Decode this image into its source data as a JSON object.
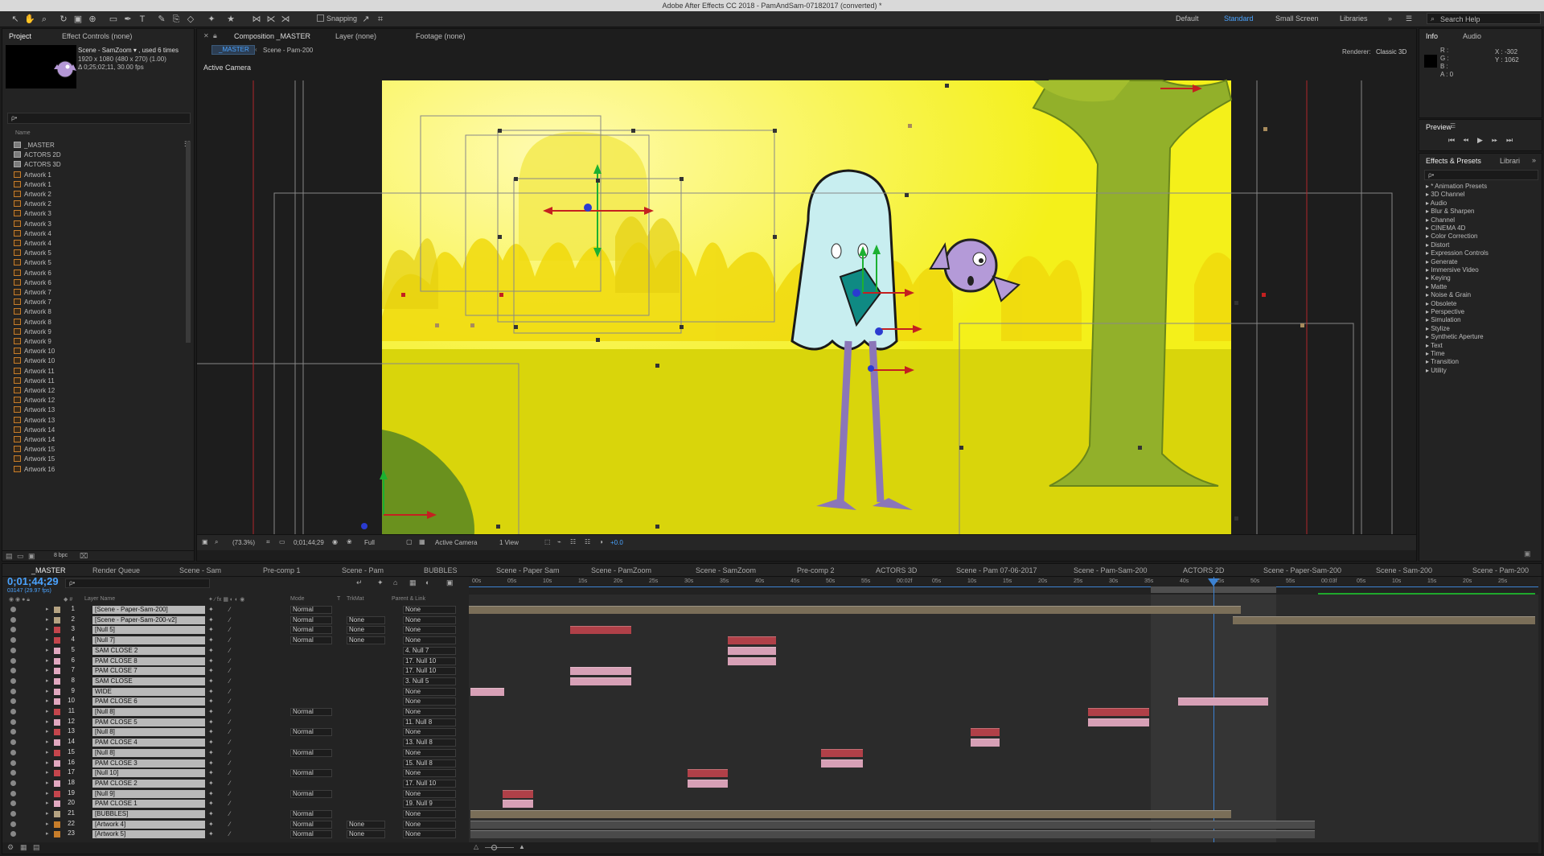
{
  "app": {
    "title": "Adobe After Effects CC 2018 - PamAndSam-07182017 (converted) *"
  },
  "workspaces": {
    "items": [
      "Default",
      "Standard",
      "Small Screen",
      "Libraries"
    ],
    "active": "Standard",
    "search_placeholder": "Search Help"
  },
  "project": {
    "tab_project": "Project",
    "tab_effect_controls": "Effect Controls (none)",
    "thumb_title": "Scene - SamZoom ▾ , used 6 times",
    "thumb_dims": "1920 x 1080 (480 x 270) (1.00)",
    "thumb_duration": "Δ 0;25;02;11, 30.00 fps",
    "search_value": "ρ•",
    "col_name": "Name",
    "bpc": "8 bpc",
    "items": [
      "_MASTER",
      "ACTORS 2D",
      "ACTORS 3D",
      "Artwork 1",
      "Artwork 1",
      "Artwork 2",
      "Artwork 2",
      "Artwork 3",
      "Artwork 3",
      "Artwork 4",
      "Artwork 4",
      "Artwork 5",
      "Artwork 5",
      "Artwork 6",
      "Artwork 6",
      "Artwork 7",
      "Artwork 7",
      "Artwork 8",
      "Artwork 8",
      "Artwork 9",
      "Artwork 9",
      "Artwork 10",
      "Artwork 10",
      "Artwork 11",
      "Artwork 11",
      "Artwork 12",
      "Artwork 12",
      "Artwork 13",
      "Artwork 13",
      "Artwork 14",
      "Artwork 14",
      "Artwork 15",
      "Artwork 15",
      "Artwork 16"
    ]
  },
  "composition": {
    "tab_label": "Composition _MASTER",
    "tab_layer": "Layer (none)",
    "tab_footage": "Footage (none)",
    "crumb_master": "_MASTER",
    "crumb_scene": "Scene - Pam-200",
    "renderer_label": "Renderer:",
    "renderer_value": "Classic 3D",
    "view_label": "Active Camera",
    "footer": {
      "zoom": "(73.3%)",
      "time": "0;01;44;29",
      "resolution": "Full",
      "camera": "Active Camera",
      "views": "1 View",
      "exposure": "+0.0"
    }
  },
  "info": {
    "tab_info": "Info",
    "tab_audio": "Audio",
    "r": "R :",
    "g": "G :",
    "b": "B :",
    "a": "A :  0",
    "x": "X : -302",
    "y": "Y : 1062"
  },
  "preview": {
    "title": "Preview"
  },
  "effects": {
    "tab": "Effects & Presets",
    "tab2": "Librari",
    "search_value": "ρ•",
    "items": [
      "* Animation Presets",
      "3D Channel",
      "Audio",
      "Blur & Sharpen",
      "Channel",
      "CINEMA 4D",
      "Color Correction",
      "Distort",
      "Expression Controls",
      "Generate",
      "Immersive Video",
      "Keying",
      "Matte",
      "Noise & Grain",
      "Obsolete",
      "Perspective",
      "Simulation",
      "Stylize",
      "Synthetic Aperture",
      "Text",
      "Time",
      "Transition",
      "Utility"
    ]
  },
  "timeline": {
    "tabs": [
      "_MASTER",
      "Render Queue",
      "Scene - Sam",
      "Pre-comp 1",
      "Scene - Pam",
      "BUBBLES",
      "Scene - Paper Sam",
      "Scene - PamZoom",
      "Scene - SamZoom",
      "Pre-comp 2",
      "ACTORS 3D",
      "Scene - Pam 07-06-2017",
      "Scene - Pam-Sam-200",
      "ACTORS 2D",
      "Scene - Paper-Sam-200",
      "Scene - Sam-200",
      "Scene - Pam-200"
    ],
    "timecode": "0;01;44;29",
    "frame_info": "03147 (29.97 fps)",
    "search_value": "ρ•",
    "col_layer": "Layer Name",
    "col_mode": "Mode",
    "col_t": "T",
    "col_trkmat": "TrkMat",
    "col_parent": "Parent & Link",
    "ruler": [
      "00s",
      "05s",
      "10s",
      "15s",
      "20s",
      "25s",
      "30s",
      "35s",
      "40s",
      "45s",
      "50s",
      "55s",
      "00:02f",
      "05s",
      "10s",
      "15s",
      "20s",
      "25s",
      "30s",
      "35s",
      "40s",
      "45s",
      "50s",
      "55s",
      "00:03f",
      "05s",
      "10s",
      "15s",
      "20s",
      "25s"
    ],
    "layers": [
      {
        "num": "1",
        "name": "[Scene - Paper-Sam-200]",
        "mode": "Normal",
        "trk": "",
        "parent": "None",
        "color": "#b5a382"
      },
      {
        "num": "2",
        "name": "[Scene - Paper-Sam-200-v2]",
        "mode": "Normal",
        "trk": "None",
        "parent": "None",
        "color": "#b5a382"
      },
      {
        "num": "3",
        "name": "[Null 5]",
        "mode": "Normal",
        "trk": "None",
        "parent": "None",
        "color": "#c4454c"
      },
      {
        "num": "4",
        "name": "[Null 7]",
        "mode": "Normal",
        "trk": "None",
        "parent": "None",
        "color": "#c4454c"
      },
      {
        "num": "5",
        "name": "SAM CLOSE 2",
        "mode": "",
        "trk": "",
        "parent": "4. Null 7",
        "color": "#e1a8c0"
      },
      {
        "num": "6",
        "name": "PAM CLOSE 8",
        "mode": "",
        "trk": "",
        "parent": "17. Null 10",
        "color": "#e1a8c0"
      },
      {
        "num": "7",
        "name": "PAM CLOSE 7",
        "mode": "",
        "trk": "",
        "parent": "17. Null 10",
        "color": "#e1a8c0"
      },
      {
        "num": "8",
        "name": "SAM CLOSE",
        "mode": "",
        "trk": "",
        "parent": "3. Null 5",
        "color": "#e1a8c0"
      },
      {
        "num": "9",
        "name": "WIDE",
        "mode": "",
        "trk": "",
        "parent": "None",
        "color": "#e1a8c0"
      },
      {
        "num": "10",
        "name": "PAM CLOSE 6",
        "mode": "",
        "trk": "",
        "parent": "None",
        "color": "#e1a8c0"
      },
      {
        "num": "11",
        "name": "[Null 8]",
        "mode": "Normal",
        "trk": "",
        "parent": "None",
        "color": "#c4454c"
      },
      {
        "num": "12",
        "name": "PAM CLOSE 5",
        "mode": "",
        "trk": "",
        "parent": "11. Null 8",
        "color": "#e1a8c0"
      },
      {
        "num": "13",
        "name": "[Null 8]",
        "mode": "Normal",
        "trk": "",
        "parent": "None",
        "color": "#c4454c"
      },
      {
        "num": "14",
        "name": "PAM CLOSE 4",
        "mode": "",
        "trk": "",
        "parent": "13. Null 8",
        "color": "#e1a8c0"
      },
      {
        "num": "15",
        "name": "[Null 8]",
        "mode": "Normal",
        "trk": "",
        "parent": "None",
        "color": "#c4454c"
      },
      {
        "num": "16",
        "name": "PAM CLOSE 3",
        "mode": "",
        "trk": "",
        "parent": "15. Null 8",
        "color": "#e1a8c0"
      },
      {
        "num": "17",
        "name": "[Null 10]",
        "mode": "Normal",
        "trk": "",
        "parent": "None",
        "color": "#c4454c"
      },
      {
        "num": "18",
        "name": "PAM CLOSE 2",
        "mode": "",
        "trk": "",
        "parent": "17. Null 10",
        "color": "#e1a8c0"
      },
      {
        "num": "19",
        "name": "[Null 9]",
        "mode": "Normal",
        "trk": "",
        "parent": "None",
        "color": "#c4454c"
      },
      {
        "num": "20",
        "name": "PAM CLOSE 1",
        "mode": "",
        "trk": "",
        "parent": "19. Null 9",
        "color": "#e1a8c0"
      },
      {
        "num": "21",
        "name": "[BUBBLES]",
        "mode": "Normal",
        "trk": "",
        "parent": "None",
        "color": "#b5a382"
      },
      {
        "num": "22",
        "name": "[Artwork 4]",
        "mode": "Normal",
        "trk": "None",
        "parent": "None",
        "color": "#c77d2a"
      },
      {
        "num": "23",
        "name": "[Artwork 5]",
        "mode": "Normal",
        "trk": "None",
        "parent": "None",
        "color": "#c77d2a"
      }
    ]
  }
}
